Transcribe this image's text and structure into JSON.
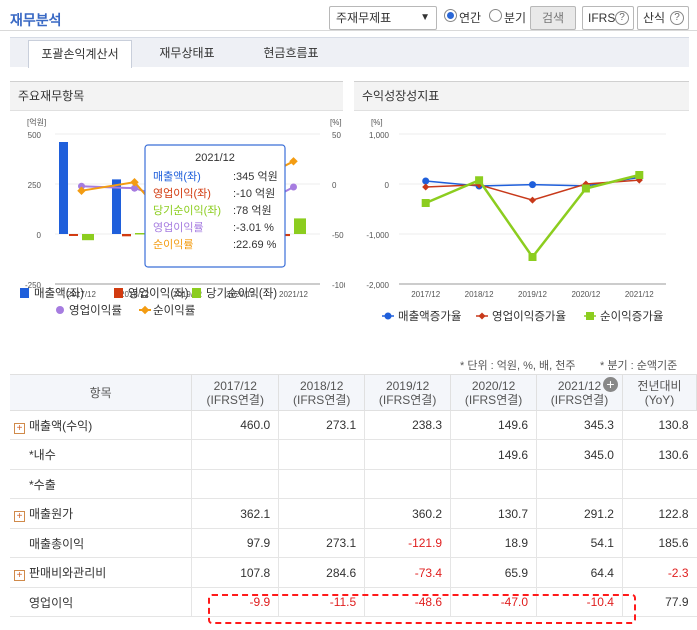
{
  "header": {
    "title": "재무분석",
    "select_value": "주재무제표",
    "period_options": [
      "연간",
      "분기"
    ],
    "period_selected": "연간",
    "search_label": "검색",
    "ifrs_label": "IFRS",
    "calc_label": "산식"
  },
  "tabs": [
    "포괄손익계산서",
    "재무상태표",
    "현금흐름표"
  ],
  "panels": {
    "left_title": "주요재무항목",
    "right_title": "수익성장성지표"
  },
  "chart_data": [
    {
      "type": "bar",
      "categories": [
        "2017/12",
        "2018/12",
        "2019/12",
        "2020/12",
        "2021/12"
      ],
      "y_left_unit": "[억원]",
      "y_right_unit": "[%]",
      "y_left_ticks": [
        "500",
        "250",
        "0",
        "-250"
      ],
      "y_right_ticks": [
        "50",
        "0",
        "-50",
        "-100"
      ],
      "ylim_left": [
        -250,
        500
      ],
      "ylim_right": [
        -100,
        50
      ],
      "series": [
        {
          "name": "매출액(좌)",
          "kind": "bar",
          "axis": "left",
          "color": "#1f5fdb",
          "values": [
            460.0,
            273.1,
            238.3,
            149.6,
            345.3
          ]
        },
        {
          "name": "영업이익(좌)",
          "kind": "bar",
          "axis": "left",
          "color": "#d23b10",
          "values": [
            -9.9,
            -11.5,
            -48.6,
            -47.0,
            -10.4
          ]
        },
        {
          "name": "당기순이익(좌)",
          "kind": "bar",
          "axis": "left",
          "color": "#8ccd1f",
          "values": [
            -31,
            5,
            -140,
            -7,
            78
          ]
        },
        {
          "name": "영업이익률",
          "kind": "line",
          "axis": "right",
          "color": "#a67ce0",
          "values": [
            -2.2,
            -4.2,
            -20.4,
            -31.4,
            -3.01
          ]
        },
        {
          "name": "순이익률",
          "kind": "line",
          "axis": "right",
          "color": "#f39c12",
          "values": [
            -6.7,
            1.8,
            -58.8,
            -4.7,
            22.69
          ]
        }
      ],
      "tooltip": {
        "title": "2021/12",
        "rows": [
          {
            "label": "매출액(좌)",
            "value": "345 억원",
            "color": "#1f5fdb"
          },
          {
            "label": "영업이익(좌)",
            "value": "-10 억원",
            "color": "#d23b10"
          },
          {
            "label": "당기순이익(좌)",
            "value": "78 억원",
            "color": "#8ccd1f"
          },
          {
            "label": "영업이익률",
            "value": "-3.01 %",
            "color": "#a67ce0"
          },
          {
            "label": "순이익률",
            "value": "22.69 %",
            "color": "#f39c12"
          }
        ]
      }
    },
    {
      "type": "line",
      "categories": [
        "2017/12",
        "2018/12",
        "2019/12",
        "2020/12",
        "2021/12"
      ],
      "y_unit": "[%]",
      "y_ticks": [
        "1,000",
        "0",
        "-1,000",
        "-2,000"
      ],
      "ylim": [
        -2000,
        1000
      ],
      "series": [
        {
          "name": "매출액증가율",
          "color": "#1f5fdb",
          "marker": "circle",
          "values": [
            60,
            -40,
            -13,
            -37,
            131
          ]
        },
        {
          "name": "영업이익증가율",
          "color": "#c8391a",
          "marker": "diamond",
          "values": [
            -60,
            -16,
            -323,
            0,
            78
          ]
        },
        {
          "name": "순이익증가율",
          "color": "#8ccd1f",
          "marker": "square",
          "values": [
            -380,
            75,
            -1460,
            -90,
            180
          ]
        }
      ]
    }
  ],
  "notes": {
    "left": "* 단위 : 억원, %, 배, 천주",
    "right": "* 분기 : 순액기준"
  },
  "table": {
    "headers": [
      {
        "line1": "항목",
        "line2": ""
      },
      {
        "line1": "2017/12",
        "line2": "(IFRS연결)"
      },
      {
        "line1": "2018/12",
        "line2": "(IFRS연결)"
      },
      {
        "line1": "2019/12",
        "line2": "(IFRS연결)"
      },
      {
        "line1": "2020/12",
        "line2": "(IFRS연결)"
      },
      {
        "line1": "2021/12",
        "line2": "(IFRS연결)"
      },
      {
        "line1": "전년대비",
        "line2": "(YoY)"
      }
    ],
    "rows": [
      {
        "label": "매출액(수익)",
        "expand": true,
        "cells": [
          "460.0",
          "273.1",
          "238.3",
          "149.6",
          "345.3",
          "130.8"
        ]
      },
      {
        "label": "*내수",
        "expand": false,
        "cells": [
          "",
          "",
          "",
          "149.6",
          "345.0",
          "130.6"
        ]
      },
      {
        "label": "*수출",
        "expand": false,
        "cells": [
          "",
          "",
          "",
          "",
          "",
          ""
        ]
      },
      {
        "label": "매출원가",
        "expand": true,
        "cells": [
          "362.1",
          "",
          "360.2",
          "130.7",
          "291.2",
          "122.8"
        ]
      },
      {
        "label": "매출총이익",
        "expand": false,
        "cells": [
          "97.9",
          "273.1",
          "-121.9",
          "18.9",
          "54.1",
          "185.6"
        ]
      },
      {
        "label": "판매비와관리비",
        "expand": true,
        "cells": [
          "107.8",
          "284.6",
          "-73.4",
          "65.9",
          "64.4",
          "-2.3"
        ]
      },
      {
        "label": "영업이익",
        "expand": false,
        "cells": [
          "-9.9",
          "-11.5",
          "-48.6",
          "-47.0",
          "-10.4",
          "77.9"
        ]
      }
    ]
  }
}
